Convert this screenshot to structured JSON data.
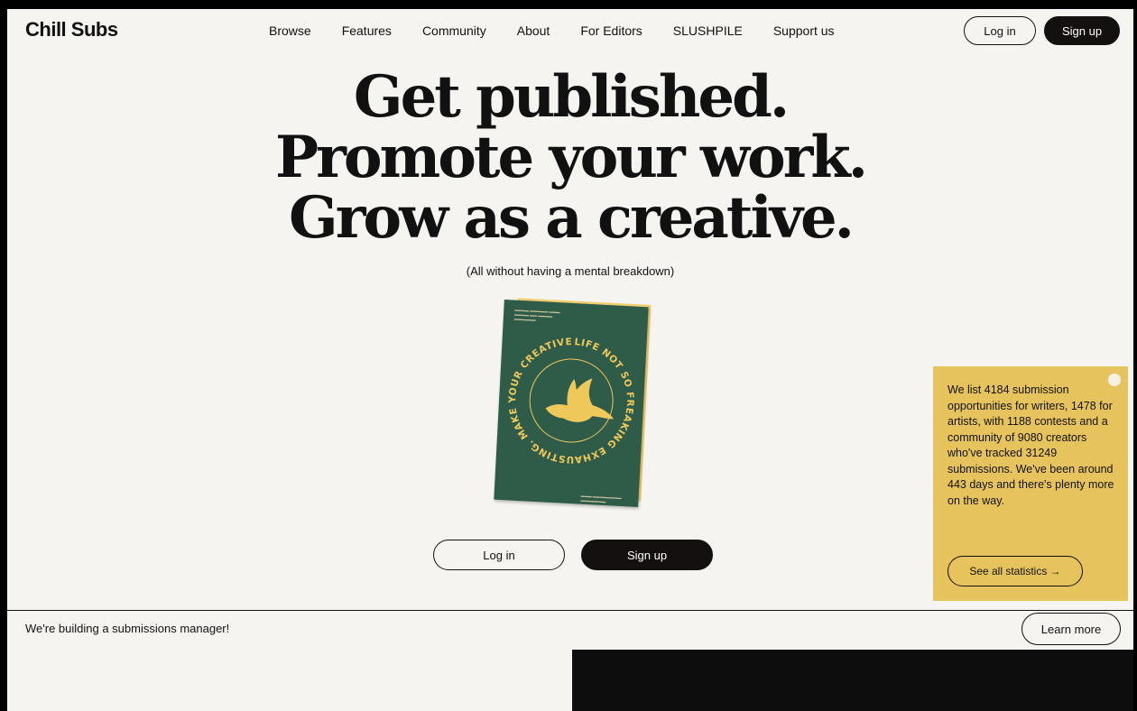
{
  "header": {
    "logo": "Chill Subs",
    "nav": [
      "Browse",
      "Features",
      "Community",
      "About",
      "For Editors",
      "SLUSHPILE",
      "Support us"
    ],
    "login_label": "Log in",
    "signup_label": "Sign up"
  },
  "hero": {
    "title_lines": [
      "Get published.",
      "Promote your work.",
      "Grow as a creative."
    ],
    "subtitle": "(All without having a mental breakdown)",
    "book": {
      "ring_text": "LIFE NOT SO FREAKING EXHAUSTING. MAKE YOUR CREATIVE",
      "icon": "dove-icon"
    },
    "login_label": "Log in",
    "signup_label": "Sign up"
  },
  "stats": {
    "text": "We list 4184 submission opportunities for writers, 1478 for artists, with 1188 contests and a community of 9080 creators who've tracked 31249 submissions. We've been around 443 days and there's plenty more on the way.",
    "button_label": "See all statistics →"
  },
  "banner": {
    "text": "We're building a submissions manager!",
    "button_label": "Learn more"
  },
  "colors": {
    "background": "#f5f4f1",
    "dark": "#141010",
    "book_green": "#2f5b49",
    "book_yellow": "#f3cf72",
    "stats_yellow": "#e7c35e"
  }
}
